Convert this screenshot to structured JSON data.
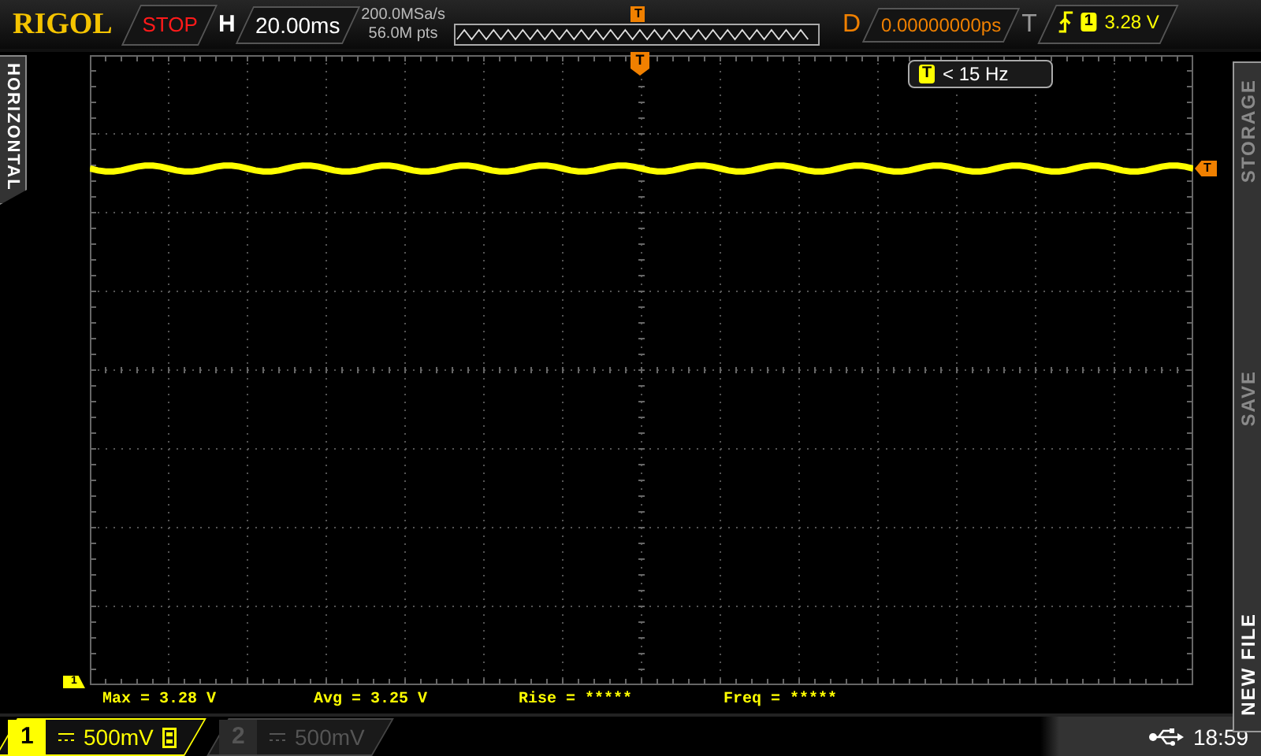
{
  "brand": "RIGOL",
  "run_state": {
    "label": "STOP",
    "stopped": true
  },
  "timebase": {
    "label": "H",
    "value": "20.00ms"
  },
  "acquisition": {
    "sample_rate": "200.0MSa/s",
    "memory_depth": "56.0M pts"
  },
  "memory_bar": {
    "trigger_marker": "T"
  },
  "delay": {
    "label": "D",
    "value": "0.00000000ps"
  },
  "trigger": {
    "label": "T",
    "source": "1",
    "level": "3.28 V"
  },
  "frequency_counter": {
    "source": "T",
    "value": "< 15 Hz"
  },
  "side_tab": {
    "label": "HORIZONTAL"
  },
  "markers": {
    "trigger_position": "T",
    "trigger_level": "T",
    "channel": "1"
  },
  "right_menu": [
    {
      "label": "NEW FILE",
      "selected": true
    },
    {
      "label": "SAVE",
      "selected": false
    },
    {
      "label": "STORAGE",
      "selected": false
    }
  ],
  "measurements": [
    "Max = 3.28 V",
    "Avg = 3.25 V",
    "Rise = *****",
    "Freq = *****"
  ],
  "channels": [
    {
      "number": "1",
      "scale": "500mV",
      "enabled": true,
      "bandwidth_limit": true
    },
    {
      "number": "2",
      "scale": "500mV",
      "enabled": false,
      "bandwidth_limit": false
    }
  ],
  "status": {
    "time": "18:59"
  }
}
